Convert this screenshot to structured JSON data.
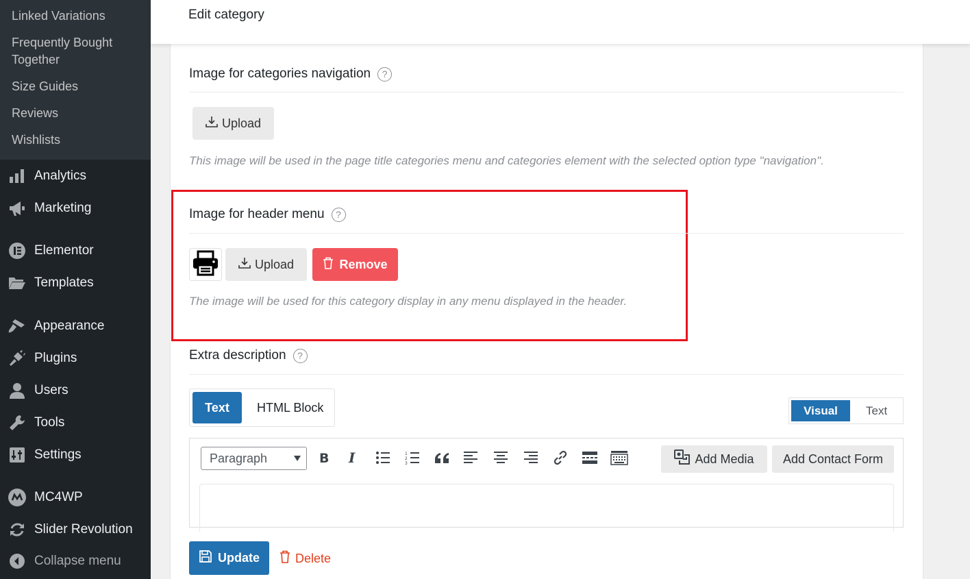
{
  "sidebar": {
    "submenu": [
      "Linked Variations",
      "Frequently Bought Together",
      "Size Guides",
      "Reviews",
      "Wishlists"
    ],
    "items": [
      {
        "label": "Analytics",
        "icon": "bar-chart-icon"
      },
      {
        "label": "Marketing",
        "icon": "megaphone-icon"
      },
      {
        "label": "Elementor",
        "icon": "elementor-icon"
      },
      {
        "label": "Templates",
        "icon": "folder-icon"
      },
      {
        "label": "Appearance",
        "icon": "paintbrush-icon"
      },
      {
        "label": "Plugins",
        "icon": "plug-icon"
      },
      {
        "label": "Users",
        "icon": "user-icon"
      },
      {
        "label": "Tools",
        "icon": "wrench-icon"
      },
      {
        "label": "Settings",
        "icon": "sliders-icon"
      },
      {
        "label": "MC4WP",
        "icon": "mc4wp-icon"
      },
      {
        "label": "Slider Revolution",
        "icon": "refresh-icon"
      },
      {
        "label": "Collapse menu",
        "icon": "collapse-icon"
      }
    ]
  },
  "header": {
    "title": "Edit category"
  },
  "nav_image": {
    "title": "Image for categories navigation",
    "upload_label": "Upload",
    "description": "This image will be used in the page title categories menu and categories element with the selected option type \"navigation\"."
  },
  "header_image": {
    "title": "Image for header menu",
    "upload_label": "Upload",
    "remove_label": "Remove",
    "description": "The image will be used for this category display in any menu displayed in the header."
  },
  "extra": {
    "title": "Extra description",
    "tabs": [
      "Text",
      "HTML Block"
    ],
    "active_tab": "Text",
    "editor_modes": [
      "Visual",
      "Text"
    ],
    "active_mode": "Visual",
    "format_value": "Paragraph",
    "add_media_label": "Add Media",
    "add_contact_form_label": "Add Contact Form"
  },
  "actions": {
    "update_label": "Update",
    "delete_label": "Delete"
  },
  "colors": {
    "primary": "#2271b1",
    "danger": "#f2545b",
    "highlight": "#e8141c",
    "sidebar": "#1d2327"
  }
}
